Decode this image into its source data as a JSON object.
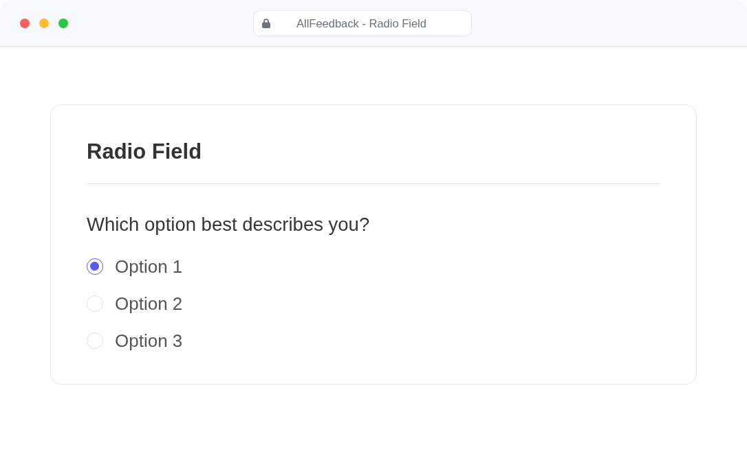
{
  "window": {
    "address_bar": {
      "title": "AllFeedback - Radio Field"
    }
  },
  "form": {
    "title": "Radio Field",
    "question": "Which option best describes you?",
    "options": [
      {
        "label": "Option 1",
        "selected": true
      },
      {
        "label": "Option 2",
        "selected": false
      },
      {
        "label": "Option 3",
        "selected": false
      }
    ]
  }
}
